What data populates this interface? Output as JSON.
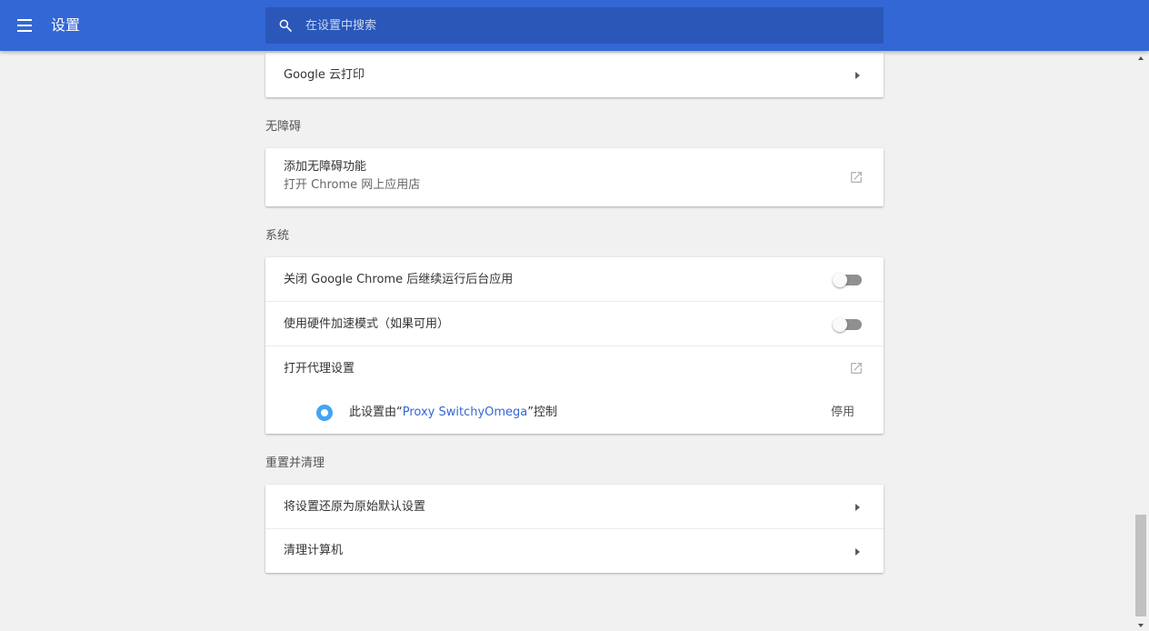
{
  "header": {
    "title": "设置",
    "search_placeholder": "在设置中搜索"
  },
  "icons": {
    "menu": "menu-icon",
    "search": "search-icon",
    "external": "open-in-new-icon",
    "chevron": "chevron-right-icon"
  },
  "colors": {
    "accent": "#3367d6",
    "search_bg": "#2a57b8",
    "background": "#f1f1f1",
    "extension_dot": "#42a5f5"
  },
  "printing": {
    "cloud_print_label": "Google 云打印"
  },
  "accessibility": {
    "section_title": "无障碍",
    "add_features_label": "添加无障碍功能",
    "add_features_sublabel": "打开 Chrome 网上应用店"
  },
  "system": {
    "section_title": "系统",
    "background_apps_label": "关闭 Google Chrome 后继续运行后台应用",
    "background_apps_enabled": false,
    "hardware_accel_label": "使用硬件加速模式（如果可用）",
    "hardware_accel_enabled": false,
    "proxy_label": "打开代理设置",
    "proxy_note_prefix": "此设置由“",
    "proxy_note_extension": "Proxy SwitchyOmega",
    "proxy_note_suffix": "”控制",
    "disable_label": "停用"
  },
  "reset": {
    "section_title": "重置并清理",
    "restore_label": "将设置还原为原始默认设置",
    "cleanup_label": "清理计算机"
  }
}
